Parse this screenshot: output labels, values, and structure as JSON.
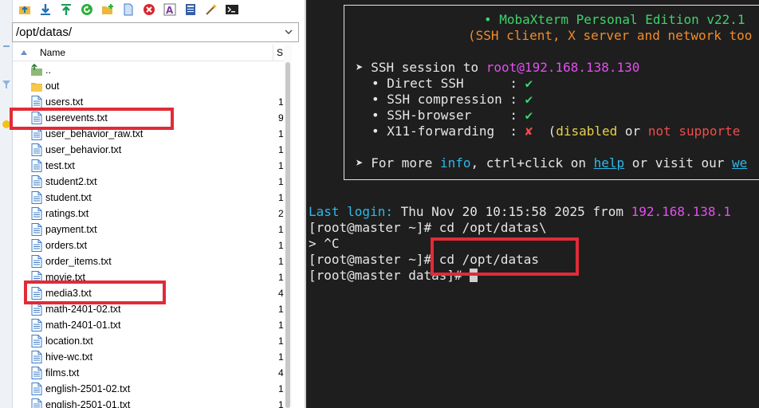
{
  "sftp": {
    "path": "/opt/datas/",
    "columns": {
      "name": "Name",
      "size": "S"
    },
    "files": [
      {
        "name": "..",
        "type": "parent",
        "size": ""
      },
      {
        "name": "out",
        "type": "folder",
        "size": ""
      },
      {
        "name": "users.txt",
        "type": "file",
        "size": "1"
      },
      {
        "name": "userevents.txt",
        "type": "file",
        "size": "9"
      },
      {
        "name": "user_behavior_raw.txt",
        "type": "file",
        "size": "1"
      },
      {
        "name": "user_behavior.txt",
        "type": "file",
        "size": "1"
      },
      {
        "name": "test.txt",
        "type": "file",
        "size": "1"
      },
      {
        "name": "student2.txt",
        "type": "file",
        "size": "1"
      },
      {
        "name": "student.txt",
        "type": "file",
        "size": "1"
      },
      {
        "name": "ratings.txt",
        "type": "file",
        "size": "2"
      },
      {
        "name": "payment.txt",
        "type": "file",
        "size": "1"
      },
      {
        "name": "orders.txt",
        "type": "file",
        "size": "1"
      },
      {
        "name": "order_items.txt",
        "type": "file",
        "size": "1"
      },
      {
        "name": "movie.txt",
        "type": "file",
        "size": "1"
      },
      {
        "name": "media3.txt",
        "type": "file",
        "size": "4"
      },
      {
        "name": "math-2401-02.txt",
        "type": "file",
        "size": "1"
      },
      {
        "name": "math-2401-01.txt",
        "type": "file",
        "size": "1"
      },
      {
        "name": "location.txt",
        "type": "file",
        "size": "1"
      },
      {
        "name": "hive-wc.txt",
        "type": "file",
        "size": "1"
      },
      {
        "name": "films.txt",
        "type": "file",
        "size": "4"
      },
      {
        "name": "english-2501-02.txt",
        "type": "file",
        "size": "1"
      },
      {
        "name": "english-2501-01.txt",
        "type": "file",
        "size": "1"
      }
    ]
  },
  "terminal": {
    "banner_title": "• MobaXterm Personal Edition v22.1",
    "banner_subtitle": "(SSH client, X server and network too",
    "session_prefix": "➤ SSH session to ",
    "session_host": "root@192.168.138.130",
    "features": [
      {
        "label": "• Direct SSH      :",
        "status": "✔"
      },
      {
        "label": "• SSH compression :",
        "status": "✔"
      },
      {
        "label": "• SSH-browser     :",
        "status": "✔"
      },
      {
        "label": "• X11-forwarding  :",
        "status": "✘"
      }
    ],
    "x11_open": "(",
    "x11_disabled": "disabled",
    "x11_or": " or ",
    "x11_not_supported": "not supporte",
    "more_prefix": "➤ For more ",
    "more_info": "info",
    "more_middle": ", ctrl+click on ",
    "more_help": "help",
    "more_suffix": " or visit our ",
    "more_web": "we",
    "last_login_label": "Last login:",
    "last_login_text": " Thu Nov 20 10:15:58 2025 from ",
    "last_login_ip": "192.168.138.1",
    "lines": [
      "[root@master ~]# cd /opt/datas\\",
      "> ^C",
      "[root@master ~]# cd /opt/datas",
      "[root@master datas]# "
    ]
  },
  "colors": {
    "highlight": "#e12b38",
    "terminal_bg": "#1e1e1e",
    "green": "#3ed36a",
    "magenta": "#e34ff0",
    "cyan": "#2fb8e8",
    "orange": "#f08c2a",
    "red": "#f04b4b",
    "yellow": "#e9d04a"
  },
  "toolbar_icons": [
    "upload-folder-icon",
    "download-icon",
    "upload-icon",
    "refresh-icon",
    "new-folder-icon",
    "new-file-icon",
    "delete-icon",
    "rename-icon",
    "text-editor-icon",
    "magic-wand-icon",
    "terminal-icon"
  ]
}
